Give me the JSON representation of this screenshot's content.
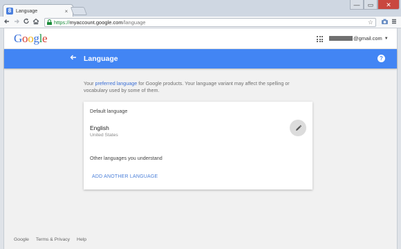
{
  "browser": {
    "tab_title": "Language",
    "tab_favicon": "8",
    "tab_close": "×",
    "url_scheme": "https://",
    "url_host": "myaccount.google.com",
    "url_path": "/language",
    "window_controls": [
      "—",
      "▭",
      "✕"
    ]
  },
  "icons": {
    "back": "arrow-left-icon",
    "forward": "arrow-right-icon",
    "reload": "reload-icon",
    "home": "home-icon",
    "lock": "lock-icon",
    "star": "star-icon",
    "camera": "camera-icon",
    "menu": "hamburger-menu-icon",
    "apps": "apps-grid-icon",
    "help": "help-icon",
    "edit": "pencil-icon"
  },
  "header": {
    "logo": "Google",
    "account_suffix": "@gmail.com"
  },
  "appbar": {
    "title": "Language",
    "help_glyph": "?"
  },
  "intro": {
    "prefix": "Your ",
    "link": "preferred language",
    "suffix": " for Google products. Your language variant may affect the spelling or vocabulary used by some of them."
  },
  "card": {
    "default_heading": "Default language",
    "language": "English",
    "variant": "United States",
    "other_heading": "Other languages you understand",
    "add_button": "ADD ANOTHER LANGUAGE"
  },
  "footer": {
    "links": [
      "Google",
      "Terms & Privacy",
      "Help"
    ]
  },
  "colors": {
    "appbar": "#4285f4",
    "link": "#3b6fd6",
    "page_bg": "#f1f1f1"
  }
}
